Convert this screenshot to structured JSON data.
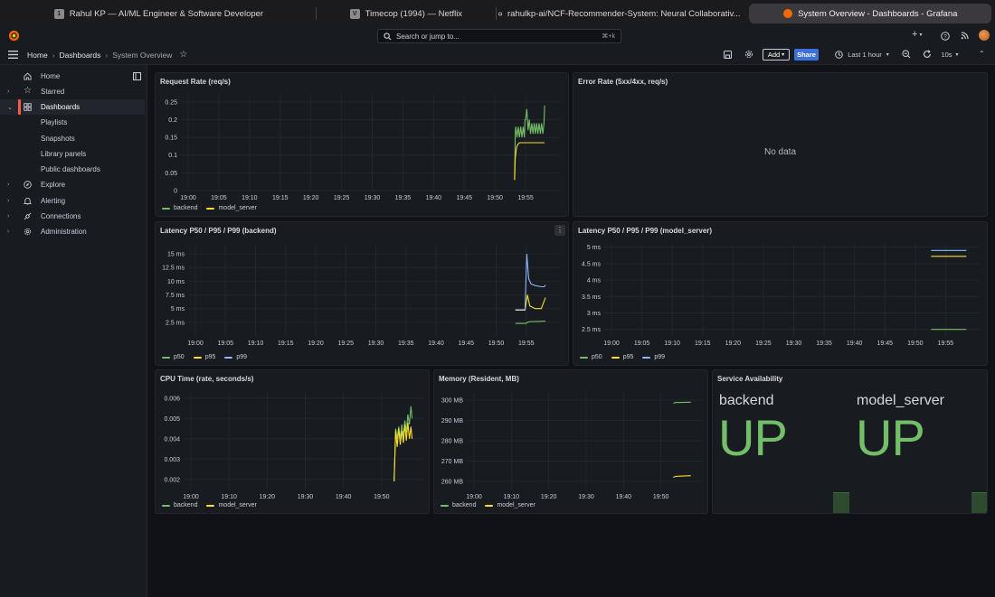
{
  "browser_tabs": [
    {
      "favicon": "1",
      "title": "Rahul KP — AI/ML Engineer & Software Developer",
      "active": false
    },
    {
      "favicon": "V",
      "title": "Timecop (1994) — Netflix",
      "active": false
    },
    {
      "favicon": "github-icon",
      "title": "rahulkp-ai/NCF-Recommender-System: Neural Collaborativ...",
      "active": false
    },
    {
      "favicon": "grafana-icon",
      "title": "System Overview - Dashboards - Grafana",
      "active": true
    }
  ],
  "topbar": {
    "search_placeholder": "Search or jump to...",
    "search_shortcut": "⌘+k",
    "plus": "+"
  },
  "breadcrumb": {
    "home": "Home",
    "dashboards": "Dashboards",
    "current": "System Overview"
  },
  "toolbar": {
    "add": "Add",
    "share": "Share",
    "time_range": "Last 1 hour",
    "refresh": "10s"
  },
  "sidebar": {
    "items": [
      {
        "label": "Home",
        "icon": "home-icon",
        "expandable": false,
        "active": false
      },
      {
        "label": "Starred",
        "icon": "star-icon",
        "expandable": true,
        "active": false
      },
      {
        "label": "Dashboards",
        "icon": "dashboards-icon",
        "expandable": true,
        "active": true
      },
      {
        "label": "Playlists",
        "sub": true
      },
      {
        "label": "Snapshots",
        "sub": true
      },
      {
        "label": "Library panels",
        "sub": true
      },
      {
        "label": "Public dashboards",
        "sub": true
      },
      {
        "label": "Explore",
        "icon": "compass-icon",
        "expandable": true,
        "active": false
      },
      {
        "label": "Alerting",
        "icon": "bell-icon",
        "expandable": true,
        "active": false
      },
      {
        "label": "Connections",
        "icon": "connections-icon",
        "expandable": true,
        "active": false
      },
      {
        "label": "Administration",
        "icon": "gear-icon",
        "expandable": true,
        "active": false
      }
    ]
  },
  "colors": {
    "green": "#73bf69",
    "yellow": "#fade2a",
    "blue": "#8ab8ff",
    "accent": "#f55f3e",
    "share": "#3d71d9"
  },
  "panels": {
    "request_rate": {
      "title": "Request Rate (req/s)"
    },
    "error_rate": {
      "title": "Error Rate (5xx/4xx, req/s)",
      "no_data": "No data"
    },
    "latency_backend": {
      "title": "Latency P50 / P95 / P99 (backend)"
    },
    "latency_model": {
      "title": "Latency P50 / P95 / P99 (model_server)"
    },
    "cpu": {
      "title": "CPU Time (rate, seconds/s)"
    },
    "memory": {
      "title": "Memory (Resident, MB)"
    },
    "availability": {
      "title": "Service Availability",
      "services": [
        {
          "name": "backend",
          "value": "UP"
        },
        {
          "name": "model_server",
          "value": "UP"
        }
      ]
    }
  },
  "chart_data": [
    {
      "id": "request_rate",
      "type": "line",
      "x_ticks": [
        "19:00",
        "19:05",
        "19:10",
        "19:15",
        "19:20",
        "19:25",
        "19:30",
        "19:35",
        "19:40",
        "19:45",
        "19:50",
        "19:55"
      ],
      "y_ticks": [
        "0.25",
        "0.2",
        "0.15",
        "0.1",
        "0.05",
        "0"
      ],
      "ylim": [
        0,
        0.27
      ],
      "series": [
        {
          "name": "backend",
          "color": "#73bf69",
          "points": [
            [
              53.2,
              0.03
            ],
            [
              53.3,
              0.16
            ],
            [
              53.4,
              0.18
            ],
            [
              53.6,
              0.15
            ],
            [
              53.8,
              0.18
            ],
            [
              54.0,
              0.15
            ],
            [
              54.2,
              0.18
            ],
            [
              54.4,
              0.15
            ],
            [
              54.6,
              0.18
            ],
            [
              54.8,
              0.15
            ],
            [
              54.9,
              0.2
            ],
            [
              55.0,
              0.2
            ],
            [
              55.2,
              0.23
            ],
            [
              55.4,
              0.17
            ],
            [
              55.6,
              0.2
            ],
            [
              55.8,
              0.16
            ],
            [
              56.0,
              0.19
            ],
            [
              56.2,
              0.16
            ],
            [
              56.4,
              0.19
            ],
            [
              56.6,
              0.16
            ],
            [
              56.8,
              0.19
            ],
            [
              57.0,
              0.16
            ],
            [
              57.2,
              0.19
            ],
            [
              57.4,
              0.16
            ],
            [
              57.6,
              0.19
            ],
            [
              57.8,
              0.16
            ],
            [
              58.0,
              0.19
            ],
            [
              58.1,
              0.24
            ]
          ]
        },
        {
          "name": "model_server",
          "color": "#fade2a",
          "points": [
            [
              53.2,
              0.03
            ],
            [
              53.3,
              0.09
            ],
            [
              53.5,
              0.12
            ],
            [
              53.7,
              0.13
            ],
            [
              54.0,
              0.135
            ],
            [
              58.1,
              0.135
            ]
          ]
        }
      ]
    },
    {
      "id": "latency_backend",
      "type": "line",
      "x_ticks": [
        "19:00",
        "19:05",
        "19:10",
        "19:15",
        "19:20",
        "19:25",
        "19:30",
        "19:35",
        "19:40",
        "19:45",
        "19:50",
        "19:55"
      ],
      "y_ticks": [
        "15 ms",
        "12.5 ms",
        "10 ms",
        "7.5 ms",
        "5 ms",
        "2.5 ms"
      ],
      "ylim": [
        0,
        16.5
      ],
      "series": [
        {
          "name": "p50",
          "color": "#73bf69",
          "points": [
            [
              53.2,
              2.3
            ],
            [
              55.0,
              2.3
            ],
            [
              55.2,
              2.5
            ],
            [
              55.6,
              2.6
            ],
            [
              58.2,
              2.7
            ]
          ]
        },
        {
          "name": "p95",
          "color": "#fade2a",
          "points": [
            [
              53.2,
              4.7
            ],
            [
              54.8,
              4.7
            ],
            [
              55.2,
              7.5
            ],
            [
              55.6,
              5.5
            ],
            [
              56.5,
              5.0
            ],
            [
              57.5,
              5.0
            ],
            [
              58.2,
              7.0
            ]
          ]
        },
        {
          "name": "p99",
          "color": "#8ab8ff",
          "points": [
            [
              53.2,
              4.8
            ],
            [
              54.8,
              4.8
            ],
            [
              55.1,
              15.0
            ],
            [
              55.4,
              10.5
            ],
            [
              55.8,
              9.5
            ],
            [
              56.5,
              9.2
            ],
            [
              57.5,
              9.0
            ],
            [
              58.0,
              9.0
            ],
            [
              58.2,
              9.3
            ]
          ]
        }
      ]
    },
    {
      "id": "latency_model",
      "type": "line",
      "x_ticks": [
        "19:00",
        "19:05",
        "19:10",
        "19:15",
        "19:20",
        "19:25",
        "19:30",
        "19:35",
        "19:40",
        "19:45",
        "19:50",
        "19:55"
      ],
      "y_ticks": [
        "5 ms",
        "4.5 ms",
        "4 ms",
        "3.5 ms",
        "3 ms",
        "2.5 ms"
      ],
      "ylim": [
        2.3,
        5.1
      ],
      "series": [
        {
          "name": "p50",
          "color": "#73bf69",
          "points": [
            [
              52.6,
              2.5
            ],
            [
              58.4,
              2.5
            ]
          ]
        },
        {
          "name": "p95",
          "color": "#fade2a",
          "points": [
            [
              52.6,
              4.72
            ],
            [
              58.4,
              4.72
            ]
          ]
        },
        {
          "name": "p99",
          "color": "#8ab8ff",
          "points": [
            [
              52.6,
              4.9
            ],
            [
              58.4,
              4.9
            ]
          ]
        }
      ]
    },
    {
      "id": "cpu",
      "type": "line",
      "x_ticks": [
        "19:00",
        "19:10",
        "19:20",
        "19:30",
        "19:40",
        "19:50"
      ],
      "y_ticks": [
        "0.006",
        "0.005",
        "0.004",
        "0.003",
        "0.002"
      ],
      "ylim": [
        0.0015,
        0.0063
      ],
      "series": [
        {
          "name": "backend",
          "color": "#73bf69",
          "points": [
            [
              53.3,
              0.0019
            ],
            [
              53.7,
              0.0045
            ],
            [
              54.1,
              0.004
            ],
            [
              54.5,
              0.0046
            ],
            [
              54.9,
              0.004
            ],
            [
              55.3,
              0.0047
            ],
            [
              55.7,
              0.0041
            ],
            [
              56.1,
              0.0049
            ],
            [
              56.5,
              0.0043
            ],
            [
              56.9,
              0.0052
            ],
            [
              57.3,
              0.0047
            ],
            [
              57.7,
              0.0056
            ],
            [
              58.0,
              0.005
            ]
          ]
        },
        {
          "name": "model_server",
          "color": "#fade2a",
          "points": [
            [
              53.3,
              0.0019
            ],
            [
              53.7,
              0.0044
            ],
            [
              54.1,
              0.0036
            ],
            [
              54.5,
              0.0045
            ],
            [
              54.9,
              0.0037
            ],
            [
              55.3,
              0.0044
            ],
            [
              55.7,
              0.0038
            ],
            [
              56.1,
              0.0047
            ],
            [
              56.5,
              0.0039
            ],
            [
              56.9,
              0.0048
            ],
            [
              57.3,
              0.004
            ],
            [
              57.7,
              0.0046
            ],
            [
              58.0,
              0.004
            ]
          ]
        }
      ]
    },
    {
      "id": "memory",
      "type": "line",
      "x_ticks": [
        "19:00",
        "19:10",
        "19:20",
        "19:30",
        "19:40",
        "19:50"
      ],
      "y_ticks": [
        "300 MB",
        "290 MB",
        "280 MB",
        "270 MB",
        "260 MB"
      ],
      "ylim": [
        256,
        304
      ],
      "series": [
        {
          "name": "backend",
          "color": "#73bf69",
          "points": [
            [
              53.3,
              298.5
            ],
            [
              54.0,
              298.8
            ],
            [
              58.0,
              299.0
            ]
          ]
        },
        {
          "name": "model_server",
          "color": "#fade2a",
          "points": [
            [
              53.3,
              262.0
            ],
            [
              54.0,
              262.5
            ],
            [
              58.0,
              262.8
            ]
          ]
        }
      ]
    }
  ]
}
